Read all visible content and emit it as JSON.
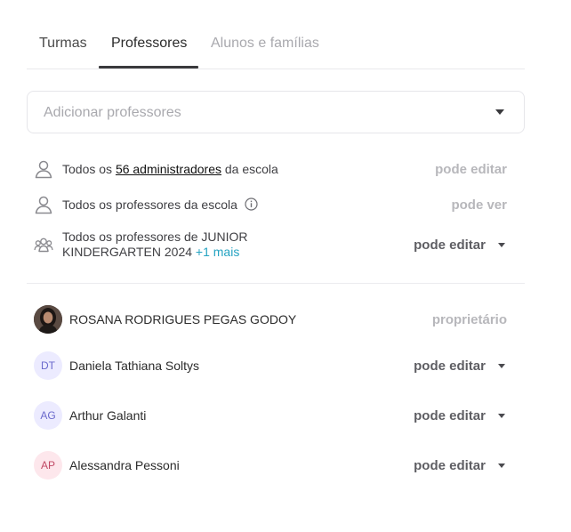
{
  "tabs": [
    {
      "label": "Turmas"
    },
    {
      "label": "Professores"
    },
    {
      "label": "Alunos e famílias"
    }
  ],
  "add_select": {
    "placeholder": "Adicionar professores"
  },
  "group_rows": [
    {
      "prefix": "Todos os ",
      "link": "56 administradores",
      "suffix": " da escola",
      "permission": "pode editar"
    },
    {
      "text": "Todos os professores da escola",
      "permission": "pode ver"
    },
    {
      "line1": "Todos os professores de JUNIOR",
      "line2": "KINDERGARTEN 2024",
      "more": "+1 mais",
      "permission": "pode editar"
    }
  ],
  "people": [
    {
      "name": "ROSANA RODRIGUES PEGAS GODOY",
      "permission": "proprietário",
      "avatar": "photo"
    },
    {
      "initials": "DT",
      "name": "Daniela Tathiana Soltys",
      "permission": "pode editar",
      "avatar_bg": "#ecebff",
      "avatar_fg": "#6b6acc"
    },
    {
      "initials": "AG",
      "name": "Arthur Galanti",
      "permission": "pode editar",
      "avatar_bg": "#ecebff",
      "avatar_fg": "#6b6acc"
    },
    {
      "initials": "AP",
      "name": "Alessandra Pessoni",
      "permission": "pode editar",
      "avatar_bg": "#fde7ec",
      "avatar_fg": "#c14a66"
    }
  ],
  "icons": {
    "admin": "person-icon",
    "teachers": "person-icon",
    "info": "info-icon",
    "group": "group-icon",
    "dropdown": "chevron-down-icon"
  }
}
